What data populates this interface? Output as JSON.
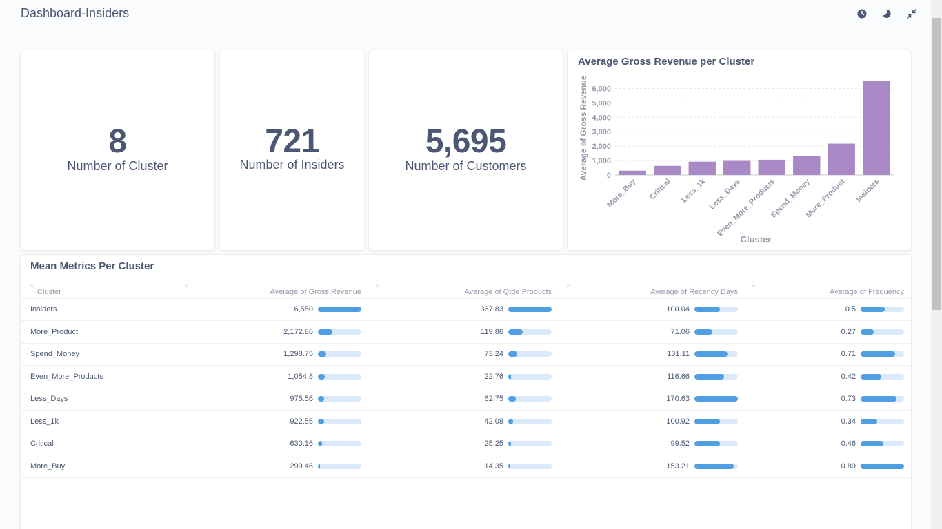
{
  "header": {
    "title": "Dashboard-Insiders",
    "icons": [
      "history-icon",
      "moon-icon",
      "minimize-icon"
    ]
  },
  "scalars": {
    "clusters": {
      "value": "8",
      "label": "Number of Cluster"
    },
    "insiders": {
      "value": "721",
      "label": "Number of Insiders"
    },
    "customers": {
      "value": "5,695",
      "label": "Number of Customers"
    }
  },
  "chart_data": {
    "type": "bar",
    "title": "Average Gross Revenue per Cluster",
    "xlabel": "Cluster",
    "ylabel": "Average of Gross Revenue",
    "categories": [
      "More_Buy",
      "Critical",
      "Less_1k",
      "Less_Days",
      "Even_More_Products",
      "Spend_Money",
      "More_Product",
      "Insiders"
    ],
    "values": [
      299.46,
      630.16,
      922.55,
      975.56,
      1054.8,
      1298.75,
      2172.86,
      6550
    ],
    "ylim": [
      0,
      6500
    ],
    "yticks": [
      "0",
      "1,000",
      "2,000",
      "3,000",
      "4,000",
      "5,000",
      "6,000"
    ],
    "grid": true,
    "color": "#a989c5"
  },
  "table": {
    "title": "Mean Metrics Per Cluster",
    "columns": [
      "Cluster",
      "Average of Gross Revenue",
      "Average of Qtde Products",
      "Average of Recency Days",
      "Average of Frequency"
    ],
    "maxima": [
      6550,
      367.83,
      170.63,
      0.89
    ],
    "rows": [
      {
        "cluster": "Insiders",
        "revenue": "6,550",
        "products": "367.83",
        "recency": "100.04",
        "frequency": "0.5"
      },
      {
        "cluster": "More_Product",
        "revenue": "2,172.86",
        "products": "119.86",
        "recency": "71.06",
        "frequency": "0.27"
      },
      {
        "cluster": "Spend_Money",
        "revenue": "1,298.75",
        "products": "73.24",
        "recency": "131.11",
        "frequency": "0.71"
      },
      {
        "cluster": "Even_More_Products",
        "revenue": "1,054.8",
        "products": "22.76",
        "recency": "116.66",
        "frequency": "0.42"
      },
      {
        "cluster": "Less_Days",
        "revenue": "975.56",
        "products": "62.75",
        "recency": "170.63",
        "frequency": "0.73"
      },
      {
        "cluster": "Less_1k",
        "revenue": "922.55",
        "products": "42.08",
        "recency": "100.92",
        "frequency": "0.34"
      },
      {
        "cluster": "Critical",
        "revenue": "630.16",
        "products": "25.25",
        "recency": "99.52",
        "frequency": "0.46"
      },
      {
        "cluster": "More_Buy",
        "revenue": "299.46",
        "products": "14.35",
        "recency": "153.21",
        "frequency": "0.89"
      }
    ]
  },
  "colors": {
    "text": "#4c5773",
    "muted": "#949aab",
    "bar": "#509ee3",
    "bar_bg": "#dbeafa",
    "chart_bar": "#a989c5"
  }
}
